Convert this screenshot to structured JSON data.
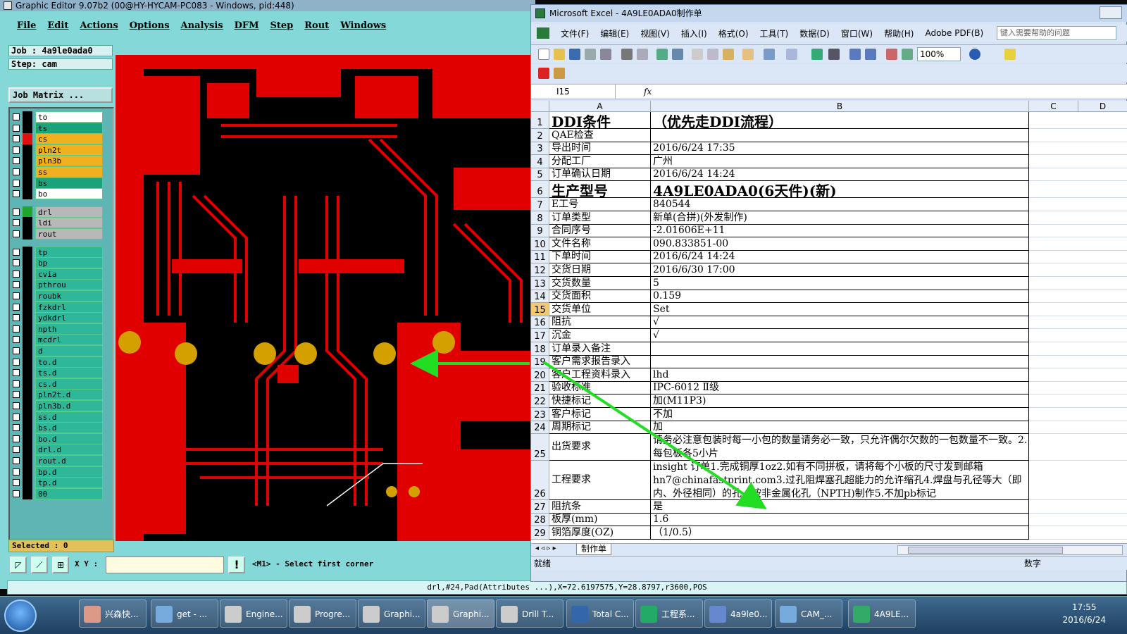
{
  "ge": {
    "title": "Graphic Editor 9.07b2 (00@HY-HYCAM-PC083 - Windows, pid:448)",
    "menu": [
      "File",
      "Edit",
      "Actions",
      "Options",
      "Analysis",
      "DFM",
      "Step",
      "Rout",
      "Windows"
    ],
    "job": "Job : 4a9le0ada0",
    "step": "Step: cam",
    "job_matrix": "Job Matrix ...",
    "selected": "Selected : 0",
    "xy_label": "X Y :",
    "prompt": "<M1> - Select first corner",
    "status": "drl,#24,Pad(Attributes ...),X=72.6197575,Y=28.8797,r3600,POS",
    "layers_a": [
      {
        "name": "to",
        "color": "#ffffff",
        "swatch": "#000000"
      },
      {
        "name": "ts",
        "color": "#1aa37a",
        "swatch": "#000000"
      },
      {
        "name": "cs",
        "color": "#f0b020",
        "swatch": "#e01010"
      },
      {
        "name": "pln2t",
        "color": "#f0b020",
        "swatch": "#000000"
      },
      {
        "name": "pln3b",
        "color": "#f0b020",
        "swatch": "#000000"
      },
      {
        "name": "ss",
        "color": "#f0b020",
        "swatch": "#000000"
      },
      {
        "name": "bs",
        "color": "#1aa37a",
        "swatch": "#000000"
      },
      {
        "name": "bo",
        "color": "#ffffff",
        "swatch": "#000000"
      }
    ],
    "layers_b": [
      {
        "name": "drl",
        "color": "#b8b8b8",
        "swatch": "#21a52a"
      },
      {
        "name": "ldi",
        "color": "#b8b8b8",
        "swatch": "#000000"
      },
      {
        "name": "rout",
        "color": "#b8b8b8",
        "swatch": "#000000"
      }
    ],
    "layers_c": [
      "tp",
      "bp",
      "cvia",
      "pthrou",
      "roubk",
      "fzkdrl",
      "ydkdrl",
      "npth",
      "mcdrl",
      "d",
      "to.d",
      "ts.d",
      "cs.d",
      "pln2t.d",
      "pln3b.d",
      "ss.d",
      "bs.d",
      "bo.d",
      "drl.d",
      "rout.d",
      "bp.d",
      "tp.d",
      "00"
    ]
  },
  "xl": {
    "title": "Microsoft Excel - 4A9LE0ADA0制作单",
    "menu": [
      "文件(F)",
      "编辑(E)",
      "视图(V)",
      "插入(I)",
      "格式(O)",
      "工具(T)",
      "数据(D)",
      "窗口(W)",
      "帮助(H)",
      "Adobe PDF(B)"
    ],
    "help_placeholder": "键入需要帮助的问题",
    "zoom": "100%",
    "namebox": "I15",
    "fx": "fx",
    "cols": [
      "A",
      "B",
      "C",
      "D"
    ],
    "sheet_tab": "制作单",
    "status_left": "就绪",
    "status_right": "数字",
    "rows": [
      {
        "n": "1",
        "a": "DDI条件",
        "b": "（优先走DDI流程）",
        "big": true
      },
      {
        "n": "2",
        "a": "QAE检查",
        "b": ""
      },
      {
        "n": "3",
        "a": "导出时间",
        "b": "2016/6/24 17:35"
      },
      {
        "n": "4",
        "a": "分配工厂",
        "b": "广州"
      },
      {
        "n": "5",
        "a": "订单确认日期",
        "b": "2016/6/24 14:24"
      },
      {
        "n": "6",
        "a": "生产型号",
        "b": "4A9LE0ADA0(6天件)(新)",
        "big": true
      },
      {
        "n": "7",
        "a": "E工号",
        "b": "840544"
      },
      {
        "n": "8",
        "a": "订单类型",
        "b": "新单(合拼)(外发制作)"
      },
      {
        "n": "9",
        "a": "合同序号",
        "b": "-2.01606E+11"
      },
      {
        "n": "10",
        "a": "文件名称",
        "b": "090.833851-00"
      },
      {
        "n": "11",
        "a": "下单时间",
        "b": "2016/6/24 14:24"
      },
      {
        "n": "12",
        "a": "交货日期",
        "b": "2016/6/30 17:00"
      },
      {
        "n": "13",
        "a": "交货数量",
        "b": "5"
      },
      {
        "n": "14",
        "a": "交货面积",
        "b": "0.159"
      },
      {
        "n": "15",
        "a": "交货单位",
        "b": "Set",
        "sel": true
      },
      {
        "n": "16",
        "a": "阻抗",
        "b": "√"
      },
      {
        "n": "17",
        "a": "沉金",
        "b": "√"
      },
      {
        "n": "18",
        "a": "订单录入备注",
        "b": ""
      },
      {
        "n": "19",
        "a": "客户需求报告录入",
        "b": ""
      },
      {
        "n": "20",
        "a": "客户工程资料录入",
        "b": "lhd"
      },
      {
        "n": "21",
        "a": "验收标准",
        "b": "IPC-6012 Ⅱ级"
      },
      {
        "n": "22",
        "a": "快捷标记",
        "b": "加(M11P3)"
      },
      {
        "n": "23",
        "a": "客户标记",
        "b": "不加"
      },
      {
        "n": "24",
        "a": "周期标记",
        "b": "加"
      },
      {
        "n": "25",
        "a": "出货要求",
        "b": "请务必注意包装时每一小包的数量请务必一致，只允许偶尔欠数的一包数量不一致。2.每包板各5小片",
        "tall": 2
      },
      {
        "n": "26",
        "a": "工程要求",
        "b": "insight 订单1.完成铜厚1oz2.如有不同拼板，请将每个小板的尺寸发到邮箱hn7@chinafastprint.com3.过孔阻焊塞孔超能力的允许缩孔4.焊盘与孔径等大（即内、外径相同）的孔，按非金属化孔（NPTH)制作5.不加pb标记",
        "tall": 3
      },
      {
        "n": "27",
        "a": "阻抗条",
        "b": "是"
      },
      {
        "n": "28",
        "a": "板厚(mm)",
        "b": "1.6"
      },
      {
        "n": "29",
        "a": "铜箔厚度(OZ)",
        "b": "（1/0.5）"
      }
    ]
  },
  "taskbar": {
    "items": [
      "兴森快...",
      "get - ...",
      "Engine...",
      "Progre...",
      "Graphi...",
      "Graphi...",
      "Drill T...",
      "Total C...",
      "工程系...",
      "4a9le0...",
      "CAM_...",
      "4A9LE..."
    ],
    "time": "17:55",
    "date": "2016/6/24"
  },
  "colors": {
    "arrow": "#22dd22",
    "copper": "#e00000",
    "pad": "#d4a000"
  }
}
